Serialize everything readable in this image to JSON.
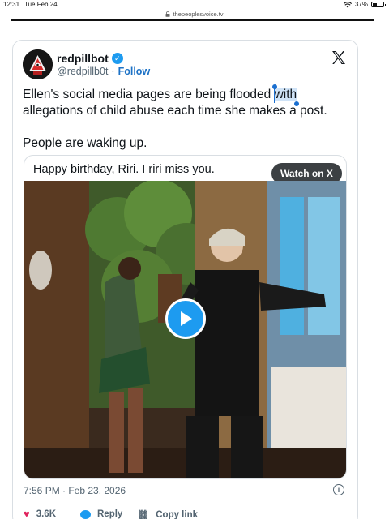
{
  "status_bar": {
    "time": "12:31",
    "date": "Tue Feb 24",
    "battery": "37%"
  },
  "browser": {
    "url": "thepeoplesvoice.tv"
  },
  "tweet": {
    "author_name": "redpillbot",
    "author_handle": "@redpillb0t",
    "separator": "·",
    "follow_label": "Follow",
    "text_before_selection": "Ellen's social media pages are being flooded ",
    "selected_word": "with",
    "text_after_selection": " allegations of child abuse each time she makes a post.",
    "text_line2": "People are waking up.",
    "embed_caption": "Happy birthday, Riri. I riri miss you.",
    "watch_label": "Watch on X",
    "timestamp": "7:56 PM · Feb 23, 2026",
    "likes": "3.6K",
    "reply_label": "Reply",
    "copy_link_label": "Copy link"
  },
  "colors": {
    "accent": "#1d9bf0",
    "like": "#e0245e",
    "text": "#0f1419",
    "muted": "#536471"
  },
  "icons": [
    "wifi-icon",
    "battery-icon",
    "lock-icon",
    "verified-icon",
    "x-logo-icon",
    "play-icon",
    "info-icon",
    "heart-icon",
    "reply-icon",
    "link-icon"
  ]
}
